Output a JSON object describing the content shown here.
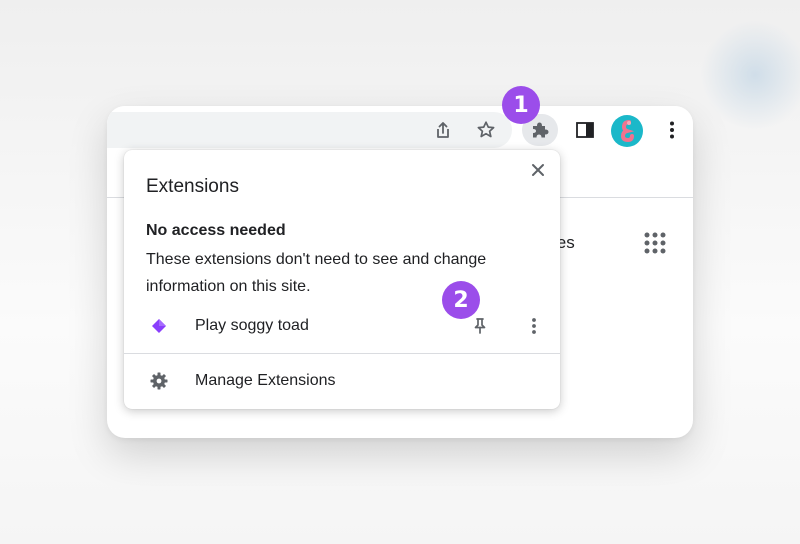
{
  "toolbar": {
    "icons": [
      "share-icon",
      "bookmark-star-icon",
      "extensions-puzzle-icon",
      "side-panel-icon",
      "avatar",
      "more-vert-icon"
    ]
  },
  "page": {
    "images_link": "Images",
    "apps_icon": "apps-grid-icon"
  },
  "badges": {
    "first": "1",
    "second": "2"
  },
  "popup": {
    "title": "Extensions",
    "section_heading": "No access needed",
    "section_desc": "These extensions don't need to see and change information on this site.",
    "extension": {
      "name": "Play soggy toad",
      "icon": "purple-diamond-icon"
    },
    "manage_label": "Manage Extensions"
  },
  "colors": {
    "badge": "#9b4dea",
    "avatar_bg": "#1bb8c9",
    "extension_icon": "#8a3ffc",
    "text": "#202124",
    "icon_gray": "#5f6368"
  }
}
